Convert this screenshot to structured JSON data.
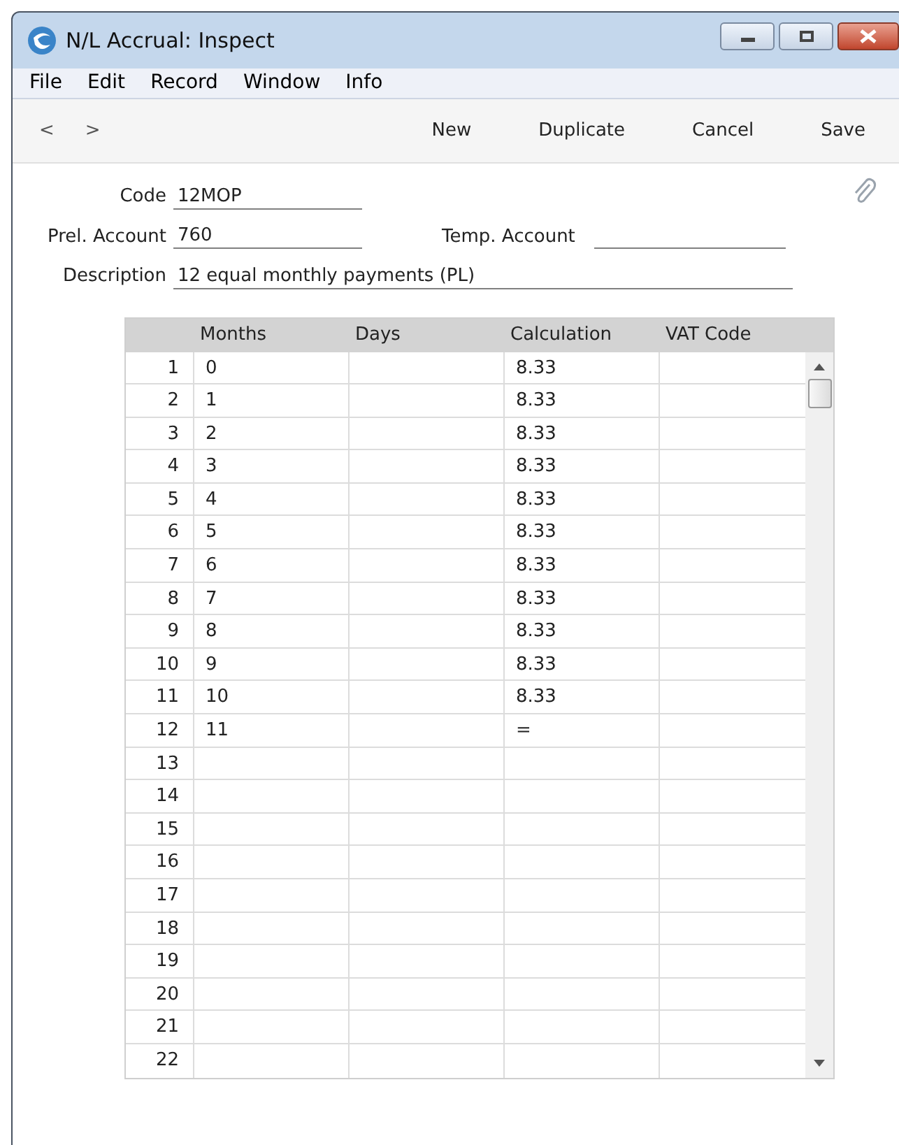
{
  "window": {
    "title": "N/L Accrual: Inspect"
  },
  "menu": [
    "File",
    "Edit",
    "Record",
    "Window",
    "Info"
  ],
  "toolbar": {
    "nav": [
      "<",
      ">"
    ],
    "buttons": [
      "New",
      "Duplicate",
      "Cancel",
      "Save"
    ]
  },
  "form": {
    "code": {
      "label": "Code",
      "value": "12MOP"
    },
    "prel_account": {
      "label": "Prel. Account",
      "value": "760"
    },
    "temp_account": {
      "label": "Temp. Account"
    },
    "description": {
      "label": "Description",
      "value": "12 equal monthly payments (PL)"
    }
  },
  "table": {
    "columns": [
      "Months",
      "Days",
      "Calculation",
      "VAT Code"
    ],
    "rows": [
      {
        "number": "1",
        "months": "0",
        "calculation": "8.33"
      },
      {
        "number": "2",
        "months": "1",
        "calculation": "8.33"
      },
      {
        "number": "3",
        "months": "2",
        "calculation": "8.33"
      },
      {
        "number": "4",
        "months": "3",
        "calculation": "8.33"
      },
      {
        "number": "5",
        "months": "4",
        "calculation": "8.33"
      },
      {
        "number": "6",
        "months": "5",
        "calculation": "8.33"
      },
      {
        "number": "7",
        "months": "6",
        "calculation": "8.33"
      },
      {
        "number": "8",
        "months": "7",
        "calculation": "8.33"
      },
      {
        "number": "9",
        "months": "8",
        "calculation": "8.33"
      },
      {
        "number": "10",
        "months": "9",
        "calculation": "8.33"
      },
      {
        "number": "11",
        "months": "10",
        "calculation": "8.33"
      },
      {
        "number": "12",
        "months": "11",
        "calculation": "="
      },
      {
        "number": "13"
      },
      {
        "number": "14"
      },
      {
        "number": "15"
      },
      {
        "number": "16"
      },
      {
        "number": "17"
      },
      {
        "number": "18"
      },
      {
        "number": "19"
      },
      {
        "number": "20"
      },
      {
        "number": "21"
      },
      {
        "number": "22"
      }
    ]
  }
}
